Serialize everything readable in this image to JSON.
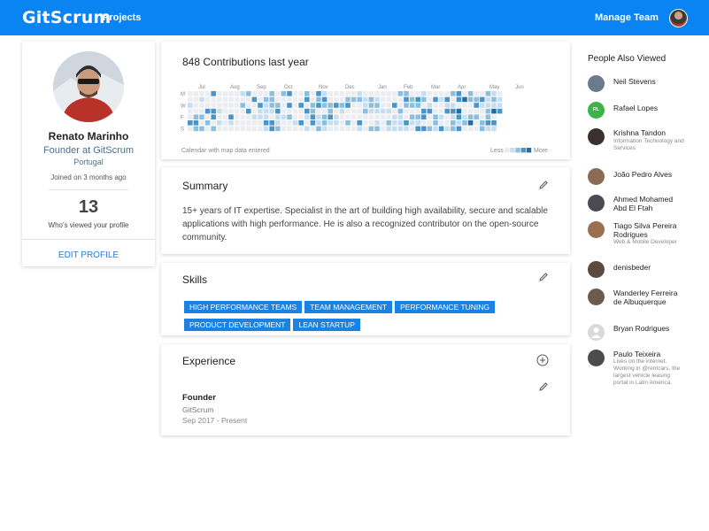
{
  "header": {
    "logo": "GitScrum",
    "nav_projects": "Projects",
    "nav_manage_team": "Manage Team",
    "brand_color": "#0b84f3"
  },
  "profile": {
    "name": "Renato Marinho",
    "role": "Founder at GitScrum",
    "location": "Portugal",
    "joined": "Joined on 3 months ago",
    "profile_views": "13",
    "profile_views_label": "Who's viewed your profile",
    "edit_label": "EDIT PROFILE"
  },
  "contributions": {
    "title": "848 Contributions last year",
    "months": [
      "Jul",
      "Aug",
      "Sep",
      "Oct",
      "Nov",
      "Dec",
      "Jan",
      "Feb",
      "Mar",
      "Apr",
      "May",
      "Jun"
    ],
    "weekdays": [
      "M",
      "W",
      "F",
      "S"
    ],
    "caption": "Calendar with map data entered",
    "legend_less": "Less",
    "legend_more": "More",
    "scale_colors": [
      "#ebedf0",
      "#c6dff0",
      "#8cbfdf",
      "#4b94c7",
      "#1d6fa5"
    ]
  },
  "summary": {
    "title": "Summary",
    "text": "15+ years of IT expertise. Specialist in the art of building high availability, secure and scalable applications with high performance. He is also a recognized contributor on the open-source community."
  },
  "skills": {
    "title": "Skills",
    "items": [
      "HIGH PERFORMANCE TEAMS",
      "TEAM MANAGEMENT",
      "PERFORMANCE TUNING",
      "PRODUCT DEVELOPMENT",
      "LEAN STARTUP"
    ]
  },
  "experience": {
    "title": "Experience",
    "items": [
      {
        "title": "Founder",
        "company": "GitScrum",
        "dates": "Sep 2017 - Present"
      }
    ]
  },
  "people": {
    "title": "People Also Viewed",
    "items": [
      {
        "name": "Neil Stevens",
        "sub": ""
      },
      {
        "name": "Rafael Lopes",
        "sub": "",
        "initials": "RL"
      },
      {
        "name": "Krishna Tandon",
        "sub": "Information Technology and Services"
      },
      {
        "name": "João Pedro Alves",
        "sub": ""
      },
      {
        "name": "Ahmed Mohamed Abd El Ftah",
        "sub": ""
      },
      {
        "name": "Tiago Silva Pereira Rodrigues",
        "sub": "Web & Mobile Developer"
      },
      {
        "name": "denisbeder",
        "sub": ""
      },
      {
        "name": "Wanderley Ferreira de Albuquerque",
        "sub": ""
      },
      {
        "name": "Bryan Rodrigues",
        "sub": ""
      },
      {
        "name": "Paulo Teixeira",
        "sub": "Lives on the internet. Working in @rentcars, the largest vehicle leasing portal in Latin America."
      }
    ]
  }
}
